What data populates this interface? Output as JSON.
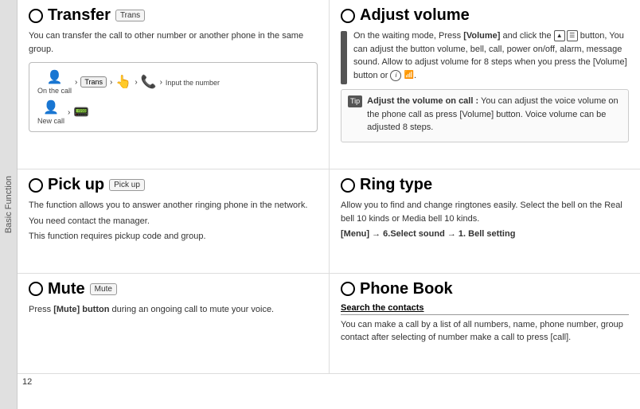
{
  "sidebar": {
    "label": "Basic Function"
  },
  "page_number": "12",
  "transfer": {
    "title": "Transfer",
    "badge": "Trans",
    "description": "You can transfer the call to other number or another phone in the same group.",
    "diagram": {
      "row1": {
        "label1": "On the call",
        "label2": "Input the number"
      },
      "row2": {
        "label1": "New call"
      }
    }
  },
  "adjust_volume": {
    "title": "Adjust volume",
    "text": "On the waiting mode, Press [Volume] and click the button, You can adjust the button volume, bell, call, power on/off, alarm, message sound. Allow to adjust volume for 8 steps when you press the [Volume] button or",
    "tip_label": "Tip",
    "tip_title": "Adjust the volume on call :",
    "tip_text": "You can adjust the voice volume on the phone call as press [Volume] button. Voice volume can be adjusted 8 steps."
  },
  "pickup": {
    "title": "Pick up",
    "badge": "Pick up",
    "line1": "The function allows you to answer another ringing phone in the network.",
    "line2": "You need contact the manager.",
    "line3": "This function requires pickup code and group."
  },
  "ring_type": {
    "title": "Ring type",
    "description": "Allow you to find and change ringtones easily. Select the bell on the Real bell 10 kinds or Media bell 10 kinds.",
    "menu_path": "[Menu] → 6.Select sound → 1. Bell setting"
  },
  "mute": {
    "title": "Mute",
    "badge": "Mute",
    "description_pre": "Press ",
    "description_bold": "[Mute] button",
    "description_post": " during an ongoing call to mute your voice."
  },
  "phone_book": {
    "title": "Phone Book",
    "subheading": "Search the contacts",
    "description": "You can make a call by a list of all numbers, name, phone number, group contact  after selecting of number make a call to press [call]."
  }
}
